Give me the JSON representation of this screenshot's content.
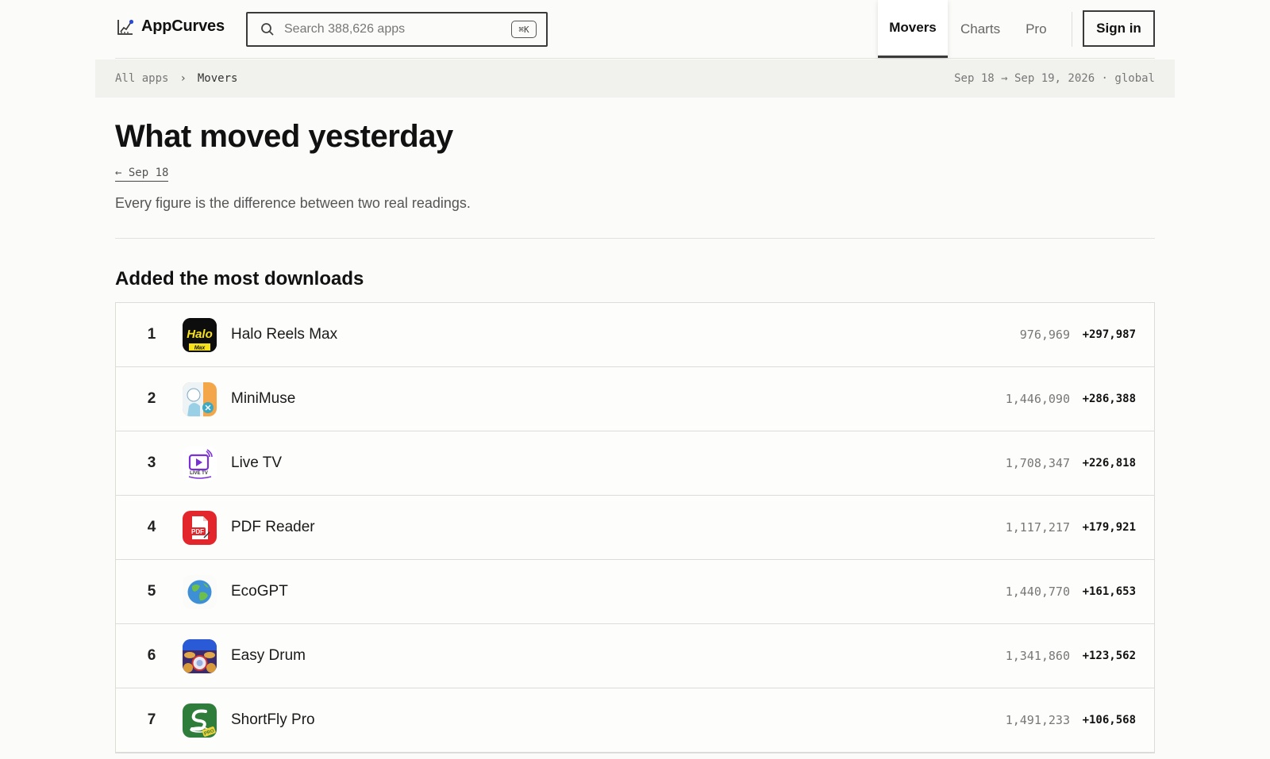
{
  "brand": {
    "name": "AppCurves"
  },
  "search": {
    "placeholder": "Search 388,626 apps",
    "shortcut": "⌘K"
  },
  "nav": {
    "items": [
      {
        "label": "Movers"
      },
      {
        "label": "Charts"
      },
      {
        "label": "Pro"
      }
    ],
    "signin_label": "Sign in"
  },
  "breadcrumb": {
    "root": "All apps",
    "separator": "›",
    "current": "Movers",
    "date_range": "Sep 18 → Sep 19, 2026 · global"
  },
  "page": {
    "title": "What moved yesterday",
    "back_link": "← Sep 18",
    "subtitle": "Every figure is the difference between two real readings."
  },
  "section": {
    "title": "Added the most downloads",
    "rows": [
      {
        "rank": "1",
        "name": "Halo Reels Max",
        "total": "976,969",
        "delta": "+297,987",
        "icon": "halo-reels-max-icon"
      },
      {
        "rank": "2",
        "name": "MiniMuse",
        "total": "1,446,090",
        "delta": "+286,388",
        "icon": "minimuse-icon"
      },
      {
        "rank": "3",
        "name": "Live TV",
        "total": "1,708,347",
        "delta": "+226,818",
        "icon": "live-tv-icon"
      },
      {
        "rank": "4",
        "name": "PDF Reader",
        "total": "1,117,217",
        "delta": "+179,921",
        "icon": "pdf-reader-icon"
      },
      {
        "rank": "5",
        "name": "EcoGPT",
        "total": "1,440,770",
        "delta": "+161,653",
        "icon": "ecogpt-icon"
      },
      {
        "rank": "6",
        "name": "Easy Drum",
        "total": "1,341,860",
        "delta": "+123,562",
        "icon": "easy-drum-icon"
      },
      {
        "rank": "7",
        "name": "ShortFly Pro",
        "total": "1,491,233",
        "delta": "+106,568",
        "icon": "shortfly-pro-icon"
      }
    ]
  },
  "icon_text": {
    "halo": "Halo",
    "halo_sub": "Max",
    "live": "LIVE TV",
    "pdf": "PDF",
    "pro": "PRO"
  }
}
